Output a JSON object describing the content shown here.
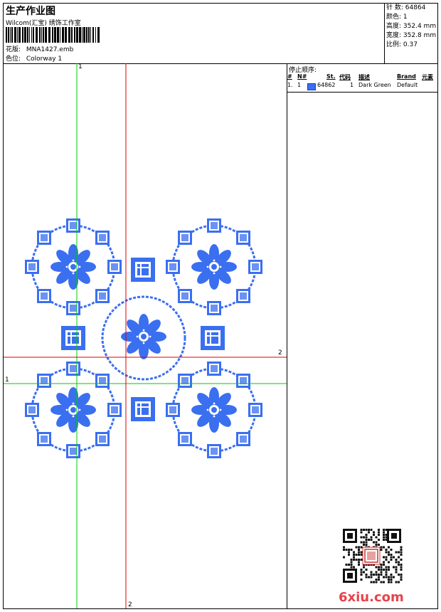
{
  "header": {
    "title": "生产作业图",
    "studio": "Wilcom(汇宝) 绣饰工作室",
    "design_label": "花版:",
    "design_value": "MNA1427.emb",
    "colorway_label": "色位:",
    "colorway_value": "Colorway 1"
  },
  "info": {
    "stitches_label": "针 数:",
    "stitches_value": "64864",
    "colors_label": "颜色:",
    "colors_value": "1",
    "height_label": "高度:",
    "height_value": "352.4 mm",
    "width_label": "宽度:",
    "width_value": "352.8 mm",
    "scale_label": "比例:",
    "scale_value": "0.37"
  },
  "stop_sequence": {
    "title": "停止顺序:",
    "columns": [
      "#",
      "N#",
      "St.",
      "代码",
      "描述",
      "Brand",
      "元素"
    ],
    "rows": [
      {
        "num": "1.",
        "n": "1",
        "stitches": "64862",
        "code": "1",
        "description": "Dark Green",
        "brand": "Default",
        "swatch_color": "#3a6ff0"
      }
    ]
  },
  "guides": {
    "green_v": "1",
    "green_h": "1",
    "red_v": "2",
    "red_h": "2"
  },
  "watermark": {
    "text": "6xiu.com"
  },
  "colors": {
    "thread": "#3a6ff0",
    "guide_green": "#00cc00",
    "guide_red": "#dd0000"
  }
}
